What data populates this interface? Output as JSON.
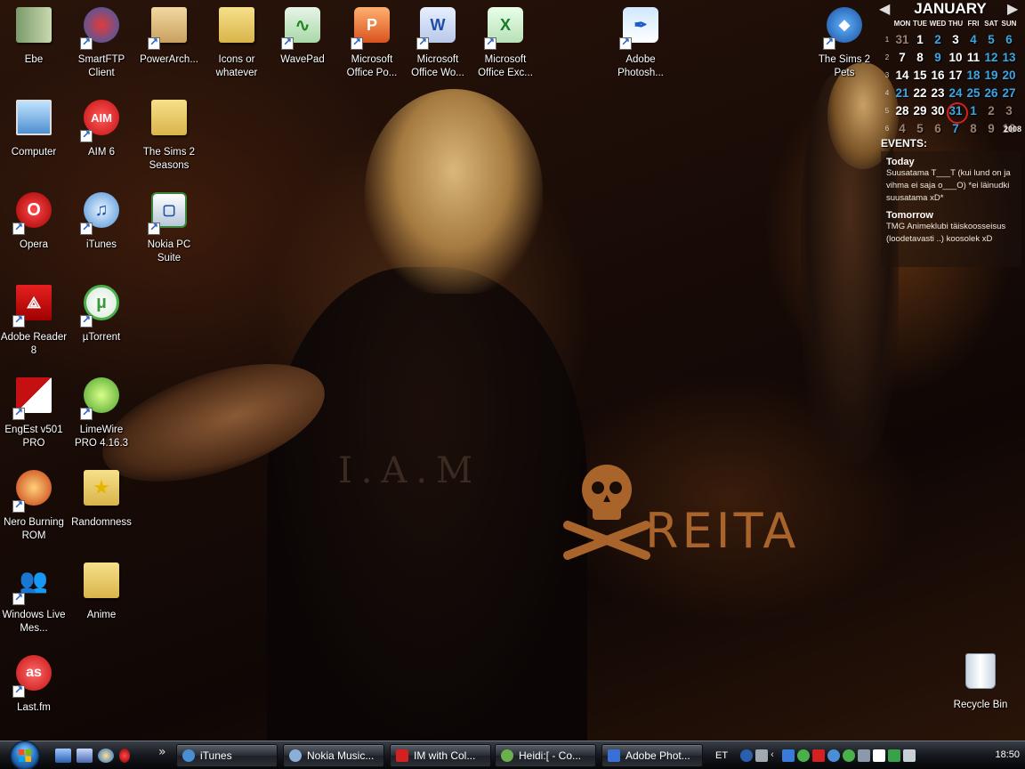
{
  "desktop": {
    "icons": [
      {
        "label": "Ebe",
        "icon": "folder-icon"
      },
      {
        "label": "SmartFTP Client",
        "icon": "smartftp-icon"
      },
      {
        "label": "PowerArch...",
        "icon": "powerarchiver-icon"
      },
      {
        "label": "Icons or whatever",
        "icon": "folder-icon"
      },
      {
        "label": "WavePad",
        "icon": "wavepad-icon"
      },
      {
        "label": "Microsoft Office Po...",
        "icon": "powerpoint-icon"
      },
      {
        "label": "Microsoft Office Wo...",
        "icon": "word-icon"
      },
      {
        "label": "Microsoft Office Exc...",
        "icon": "excel-icon"
      },
      {
        "label": "Adobe Photosh...",
        "icon": "photoshop-icon"
      },
      {
        "label": "The Sims 2 Pets",
        "icon": "sims-icon"
      },
      {
        "label": "Computer",
        "icon": "computer-icon"
      },
      {
        "label": "AIM 6",
        "icon": "aim-icon"
      },
      {
        "label": "The Sims 2 Seasons",
        "icon": "folder-icon"
      },
      {
        "label": "Opera",
        "icon": "opera-icon"
      },
      {
        "label": "iTunes",
        "icon": "itunes-icon"
      },
      {
        "label": "Nokia PC Suite",
        "icon": "nokia-icon"
      },
      {
        "label": "Adobe Reader 8",
        "icon": "adobe-reader-icon"
      },
      {
        "label": "µTorrent",
        "icon": "utorrent-icon"
      },
      {
        "label": "EngEst v501 PRO",
        "icon": "engest-icon"
      },
      {
        "label": "LimeWire PRO 4.16.3",
        "icon": "limewire-icon"
      },
      {
        "label": "Nero Burning ROM",
        "icon": "nero-icon"
      },
      {
        "label": "Randomness",
        "icon": "star-folder-icon"
      },
      {
        "label": "Windows Live Mes...",
        "icon": "messenger-icon"
      },
      {
        "label": "Anime",
        "icon": "folder-icon"
      },
      {
        "label": "Last.fm",
        "icon": "lastfm-icon"
      },
      {
        "label": "Recycle Bin",
        "icon": "recycle-bin-icon"
      }
    ]
  },
  "wallpaper": {
    "text_reita": "REITA",
    "text_shirt": "I.A.M"
  },
  "calendar": {
    "month": "JANUARY",
    "year": "2008",
    "dows": [
      "MON",
      "TUE",
      "WED",
      "THU",
      "FRI",
      "SAT",
      "SUN"
    ],
    "weeks": [
      {
        "wk": "1",
        "days": [
          "31",
          "1",
          "2",
          "3",
          "4",
          "5",
          "6"
        ]
      },
      {
        "wk": "2",
        "days": [
          "7",
          "8",
          "9",
          "10",
          "11",
          "12",
          "13"
        ]
      },
      {
        "wk": "3",
        "days": [
          "14",
          "15",
          "16",
          "17",
          "18",
          "19",
          "20"
        ]
      },
      {
        "wk": "4",
        "days": [
          "21",
          "22",
          "23",
          "24",
          "25",
          "26",
          "27"
        ]
      },
      {
        "wk": "5",
        "days": [
          "28",
          "29",
          "30",
          "31",
          "1",
          "2",
          "3"
        ]
      },
      {
        "wk": "6",
        "days": [
          "4",
          "5",
          "6",
          "7",
          "8",
          "9",
          "10"
        ]
      }
    ],
    "today": "31"
  },
  "events": {
    "heading": "EVENTS:",
    "today_title": "Today",
    "today_text": "Suusatama T___T (kui lund on ja vihma ei saja o___O) *ei läinudki suusatama xD*",
    "tomorrow_title": "Tomorrow",
    "tomorrow_text": "TMG Animeklubi täiskoosseisus (loodetavasti ..) koosolek xD"
  },
  "taskbar": {
    "buttons": [
      {
        "label": "iTunes",
        "color": "#4a8fd6"
      },
      {
        "label": "Nokia Music...",
        "color": "#8ab0d8"
      },
      {
        "label": "IM with Col...",
        "color": "#d42020"
      },
      {
        "label": "Heidi:[ - Co...",
        "color": "#6ab04c"
      },
      {
        "label": "Adobe Phot...",
        "color": "#3a6fd8"
      }
    ],
    "language": "ET",
    "clock": "18:50"
  },
  "colors": {
    "accent_blue": "#39a7e6",
    "today_ring": "#d42020",
    "reita_orange": "#a9642c"
  }
}
